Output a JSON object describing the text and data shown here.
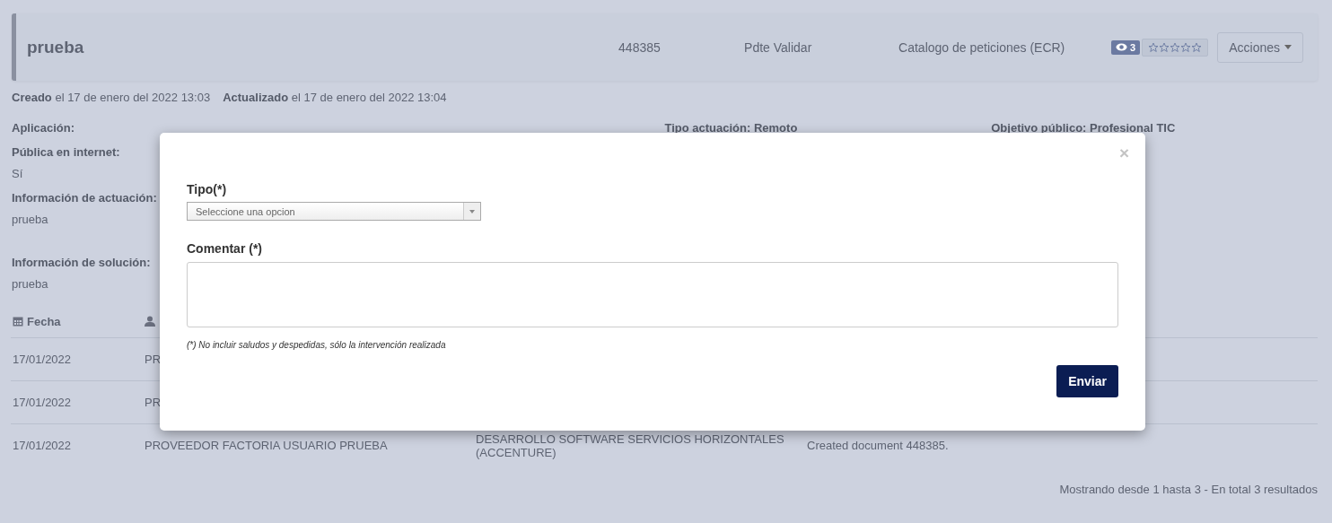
{
  "header": {
    "title": "prueba",
    "number": "448385",
    "status": "Pdte Validar",
    "catalog": "Catalogo de peticiones (ECR)",
    "views": "3",
    "stars": 0,
    "actions": "Acciones"
  },
  "meta": [
    {
      "label": "Creado",
      "text": "el 17 de enero del 2022 13:03"
    },
    {
      "label": "Actualizado",
      "text": "el 17 de enero del 2022 13:04"
    }
  ],
  "fields": [
    {
      "label": "Aplicación:"
    },
    {
      "label": "Pública en internet:",
      "value": "Sí"
    },
    {
      "label": "Información de actuación:",
      "value": "prueba"
    },
    {
      "label": "Información de solución:",
      "value": "prueba"
    }
  ],
  "side_fields": [
    "Tipo actuación: Remoto",
    "Objetivo público: Profesional TIC"
  ],
  "table": {
    "columns": [
      {
        "label": "Fecha",
        "kind": "date"
      },
      {
        "kind": "user"
      }
    ],
    "rows": [
      {
        "cells": [
          "17/01/2022",
          "PR"
        ]
      },
      {
        "cells": [
          "17/01/2022",
          "PR"
        ]
      },
      {
        "cells": [
          "17/01/2022",
          "PROVEEDOR FACTORIA USUARIO PRUEBA",
          "DESARROLLO SOFTWARE SERVICIOS HORIZONTALES (ACCENTURE)",
          "Created document 448385."
        ]
      }
    ]
  },
  "pagination": "Mostrando desde 1 hasta 3 - En total 3 resultados",
  "modal": {
    "close": "×",
    "type_label": "Tipo(*)",
    "type_placeholder": "Seleccione una opcion",
    "comment_label": "Comentar (*)",
    "note": "(*) No incluir saludos y despedidas, sólo la intervención realizada",
    "submit": "Enviar"
  }
}
